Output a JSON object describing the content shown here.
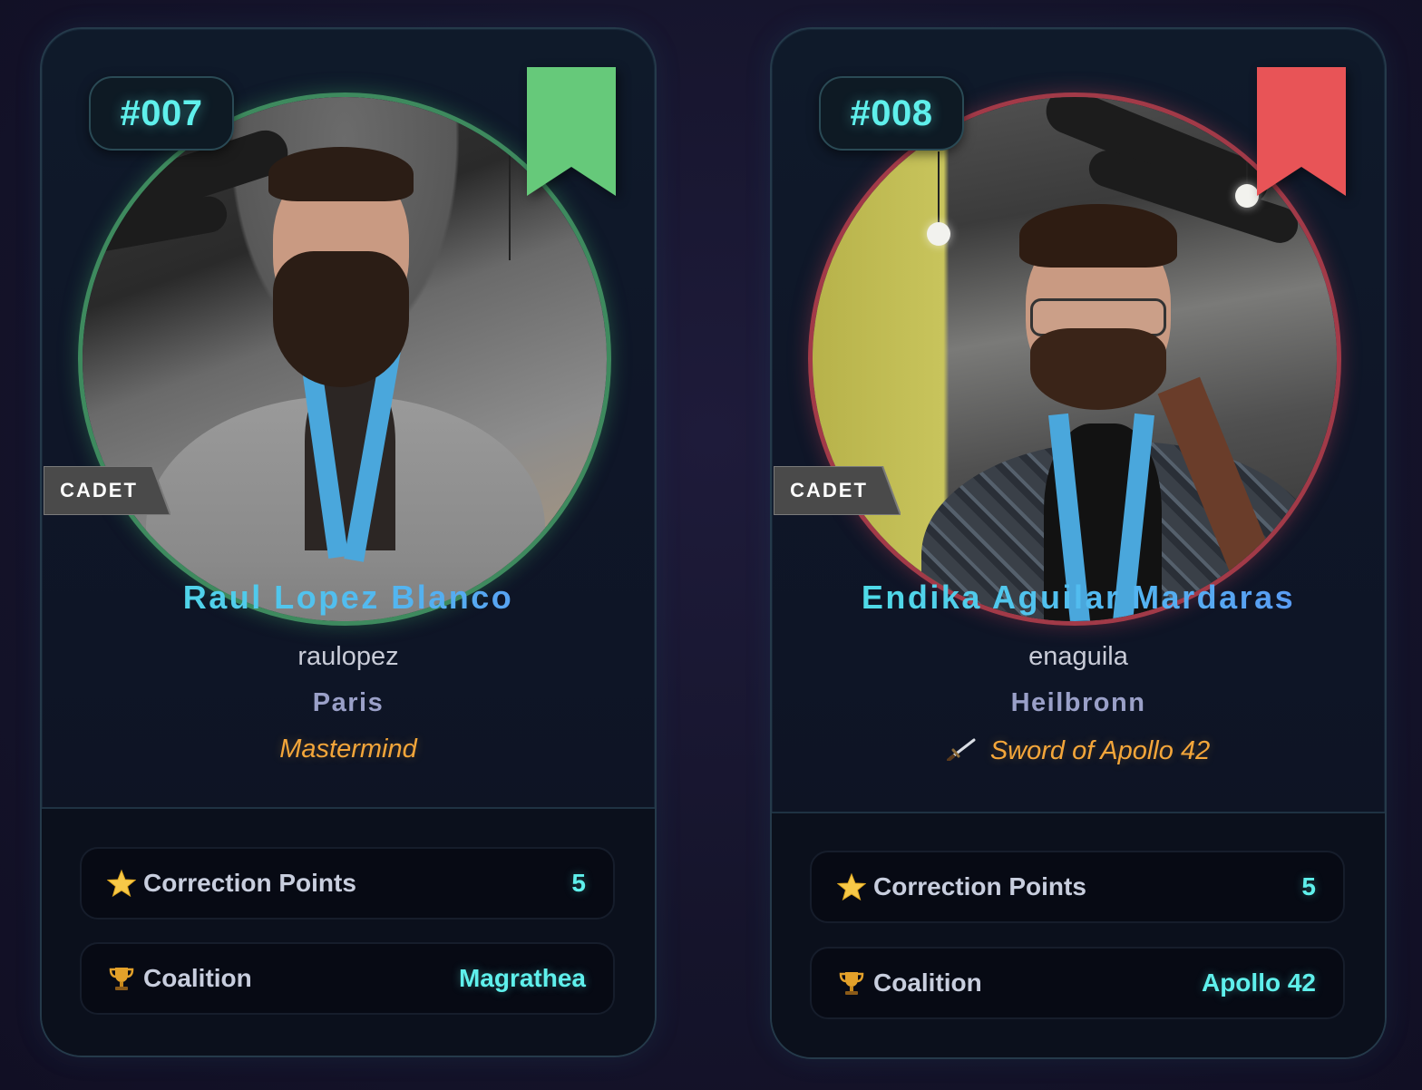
{
  "colors": {
    "accent_cyan": "#5ff0ec",
    "title_orange": "#f4a63a",
    "campus_lavender": "#9aa0c8",
    "ring_green": "#3e8a5e",
    "ring_red": "#a23a48",
    "ribbon_green": "#66c97a",
    "ribbon_red": "#e85457"
  },
  "cards": [
    {
      "number": "#007",
      "rank": "CADET",
      "ribbon_status": "green",
      "full_name": "Raul Lopez Blanco",
      "login": "raulopez",
      "campus": "Paris",
      "title": "Mastermind",
      "title_icon": "",
      "stats": [
        {
          "icon": "star-icon",
          "label": "Correction Points",
          "value": "5"
        },
        {
          "icon": "trophy-icon",
          "label": "Coalition",
          "value": "Magrathea"
        }
      ]
    },
    {
      "number": "#008",
      "rank": "CADET",
      "ribbon_status": "red",
      "full_name": "Endika Aguilar Mardaras",
      "login": "enaguila",
      "campus": "Heilbronn",
      "title": "Sword of Apollo 42",
      "title_icon": "sword-icon",
      "stats": [
        {
          "icon": "star-icon",
          "label": "Correction Points",
          "value": "5"
        },
        {
          "icon": "trophy-icon",
          "label": "Coalition",
          "value": "Apollo 42"
        }
      ]
    }
  ]
}
